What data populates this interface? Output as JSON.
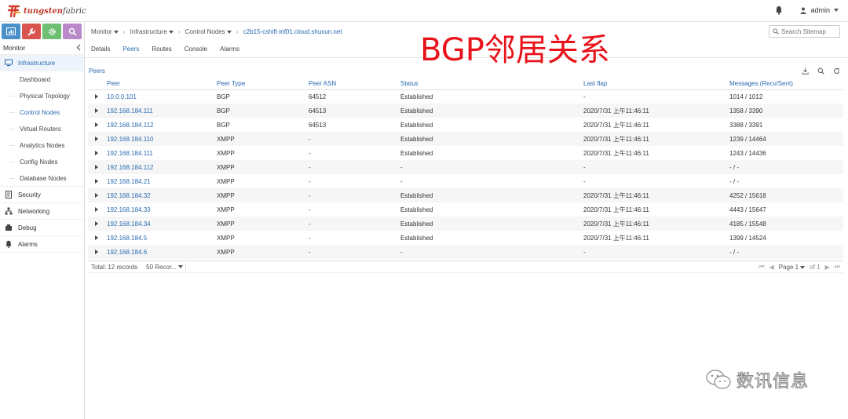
{
  "app": {
    "logo_text_prefix": "tungsten",
    "logo_text_suffix": "fabric",
    "user": "admin"
  },
  "sidebar": {
    "section_title": "Monitor",
    "items": [
      {
        "label": "Infrastructure",
        "icon": "monitor-icon",
        "active": true
      },
      {
        "label": "Dashboard",
        "sub": true,
        "dots": ""
      },
      {
        "label": "Physical Topology",
        "sub": true,
        "dots": "···"
      },
      {
        "label": "Control Nodes",
        "sub": true,
        "dots": "···",
        "active": true
      },
      {
        "label": "Virtual Routers",
        "sub": true,
        "dots": "···"
      },
      {
        "label": "Analytics Nodes",
        "sub": true,
        "dots": "···"
      },
      {
        "label": "Config Nodes",
        "sub": true,
        "dots": "···"
      },
      {
        "label": "Database Nodes",
        "sub": true,
        "dots": "···"
      },
      {
        "label": "Security",
        "icon": "security-icon"
      },
      {
        "label": "Networking",
        "icon": "networking-icon"
      },
      {
        "label": "Debug",
        "icon": "debug-icon"
      },
      {
        "label": "Alarms",
        "icon": "alarm-icon"
      }
    ]
  },
  "breadcrumb": {
    "items": [
      "Monitor",
      "Infrastructure",
      "Control Nodes"
    ],
    "current": "c2b15-cshift-inf01.cloud.shuxun.net"
  },
  "search": {
    "placeholder": "Search Sitemap"
  },
  "tabs": [
    "Details",
    "Peers",
    "Routes",
    "Console",
    "Alarms"
  ],
  "active_tab": "Peers",
  "overlay_title": "BGP邻居关系",
  "peers": {
    "title": "Peers",
    "columns": [
      "Peer",
      "Peer Type",
      "Peer ASN",
      "Status",
      "Last flap",
      "Messages (Recv/Sent)"
    ],
    "rows": [
      [
        "10.0.0.101",
        "BGP",
        "64512",
        "Established",
        "-",
        "1014 / 1012"
      ],
      [
        "192.168.184.111",
        "BGP",
        "64513",
        "Established",
        "2020/7/31 上午11:46:11",
        "1358 / 3390"
      ],
      [
        "192.168.184.112",
        "BGP",
        "64513",
        "Established",
        "2020/7/31 上午11:46:11",
        "3388 / 3391"
      ],
      [
        "192.168.184.110",
        "XMPP",
        "-",
        "Established",
        "2020/7/31 上午11:46:11",
        "1239 / 14464"
      ],
      [
        "192.168.184.111",
        "XMPP",
        "-",
        "Established",
        "2020/7/31 上午11:46:11",
        "1243 / 14436"
      ],
      [
        "192.168.184.112",
        "XMPP",
        "-",
        "-",
        "-",
        "- / -"
      ],
      [
        "192.168.184.21",
        "XMPP",
        "-",
        "-",
        "-",
        "- / -"
      ],
      [
        "192.168.184.32",
        "XMPP",
        "-",
        "Established",
        "2020/7/31 上午11:46:11",
        "4252 / 15618"
      ],
      [
        "192.168.184.33",
        "XMPP",
        "-",
        "Established",
        "2020/7/31 上午11:46:11",
        "4443 / 15647"
      ],
      [
        "192.168.184.34",
        "XMPP",
        "-",
        "Established",
        "2020/7/31 上午11:46:11",
        "4185 / 15548"
      ],
      [
        "192.168.184.5",
        "XMPP",
        "-",
        "Established",
        "2020/7/31 上午11:46:11",
        "1399 / 14524"
      ],
      [
        "192.168.184.6",
        "XMPP",
        "-",
        "-",
        "-",
        "- / -"
      ]
    ]
  },
  "pager": {
    "total": "Total: 12 records",
    "per_page": "50 Recor...",
    "page_label": "Page 1",
    "of_label": "of 1"
  },
  "watermark": {
    "text": "数讯信息"
  },
  "colors": {
    "accent": "#2a6bb0",
    "overlay": "#e8131b"
  }
}
